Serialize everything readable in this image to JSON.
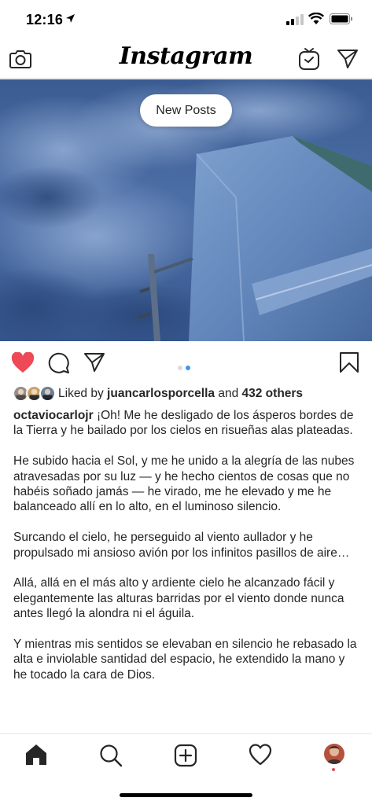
{
  "status_bar": {
    "time": "12:16"
  },
  "header": {
    "logo": "Instagram"
  },
  "feed": {
    "new_posts_label": "New Posts"
  },
  "post": {
    "liked_by_prefix": "Liked by ",
    "liked_by_user": "juancarlosporcella",
    "liked_by_and": " and ",
    "liked_by_others": "432 others",
    "carousel": {
      "total": 2,
      "active": 2
    },
    "caption_user": "octaviocarlojr",
    "caption_paragraphs": [
      "¡Oh! Me he desligado de los ásperos bordes de la Tierra y he bailado por los cielos en risueñas alas plateadas.",
      "He subido hacia el Sol, y me he unido a la alegría de las nubes atravesadas por su luz — y he hecho cientos de cosas que no habéis soñado jamás — he virado, me he elevado y me he balanceado allí en lo alto, en el luminoso silencio.",
      "Surcando el cielo, he perseguido al viento aullador y he propulsado mi ansioso avión por los infinitos pasillos de aire…",
      "Allá, allá en el más alto y ardiente cielo he alcanzado fácil y elegantemente las alturas barridas por el viento donde nunca antes llegó la alondra ni el águila.",
      "Y mientras mis sentidos se elevaban en silencio he rebasado la alta e inviolable santidad del espacio, he extendido la mano y he tocado la cara de Dios."
    ]
  },
  "colors": {
    "like_red": "#ed4956",
    "dot_active": "#3897f0",
    "dot_inactive": "#dbdbdb",
    "sky_dark": "#2b4a7a",
    "sky_light": "#6f8fc0"
  }
}
